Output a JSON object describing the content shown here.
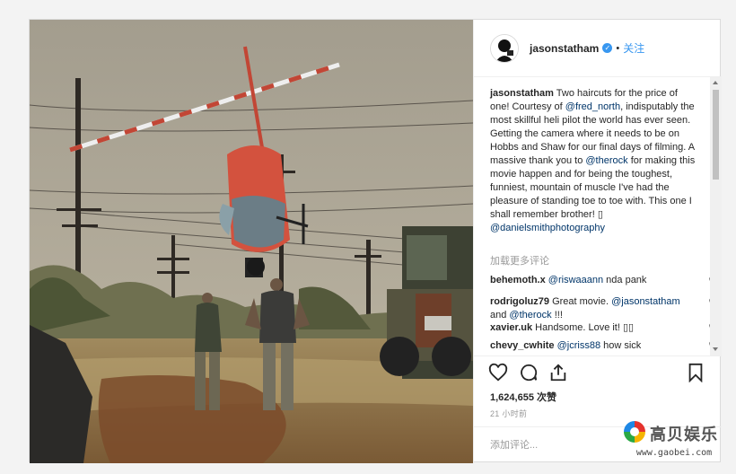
{
  "header": {
    "username": "jasonstatham",
    "separator": "•",
    "follow_label": "关注"
  },
  "caption": {
    "username": "jasonstatham",
    "text_1": " Two haircuts for the price of one! Courtesy of ",
    "mention_1": "@fred_north",
    "text_2": ", indisputably the most skillful heli pilot the world has ever seen. Getting the camera where it needs to be on Hobbs and Shaw for our final days of filming. A massive thank you to ",
    "mention_2": "@therock",
    "text_3": " for making this movie happen and for being the toughest, funniest, mountain of muscle I've had the pleasure of standing toe to toe with. This one I shall remember brother! ▯",
    "mention_3": "@danielsmithphotography"
  },
  "load_more": "加载更多评论",
  "comments": [
    {
      "user": "behemoth.x",
      "mention": "@riswaaann",
      "text": " nda pank"
    },
    {
      "user": "rodrigoluz79",
      "text_a": " Great movie. ",
      "mention_a": "@jasonstatham",
      "text_b": " and ",
      "mention_b": "@therock",
      "text_c": " !!!"
    },
    {
      "user": "xavier.uk",
      "text": " Handsome. Love it! ▯▯"
    },
    {
      "user": "chevy_cwhite",
      "mention": "@jcriss88",
      "text": " how sick"
    }
  ],
  "likes": "1,624,655 次赞",
  "time": "21 小时前",
  "comment_placeholder": "添加评论...",
  "watermark": {
    "name": "高贝娱乐",
    "url": "www.gaobei.com"
  },
  "icons": {
    "verified": "verified-badge-icon",
    "like": "heart-icon",
    "comment": "comment-icon",
    "share": "share-icon",
    "save": "bookmark-icon"
  },
  "colors": {
    "link": "#003569",
    "accent": "#3897f0",
    "muted": "#999999"
  }
}
